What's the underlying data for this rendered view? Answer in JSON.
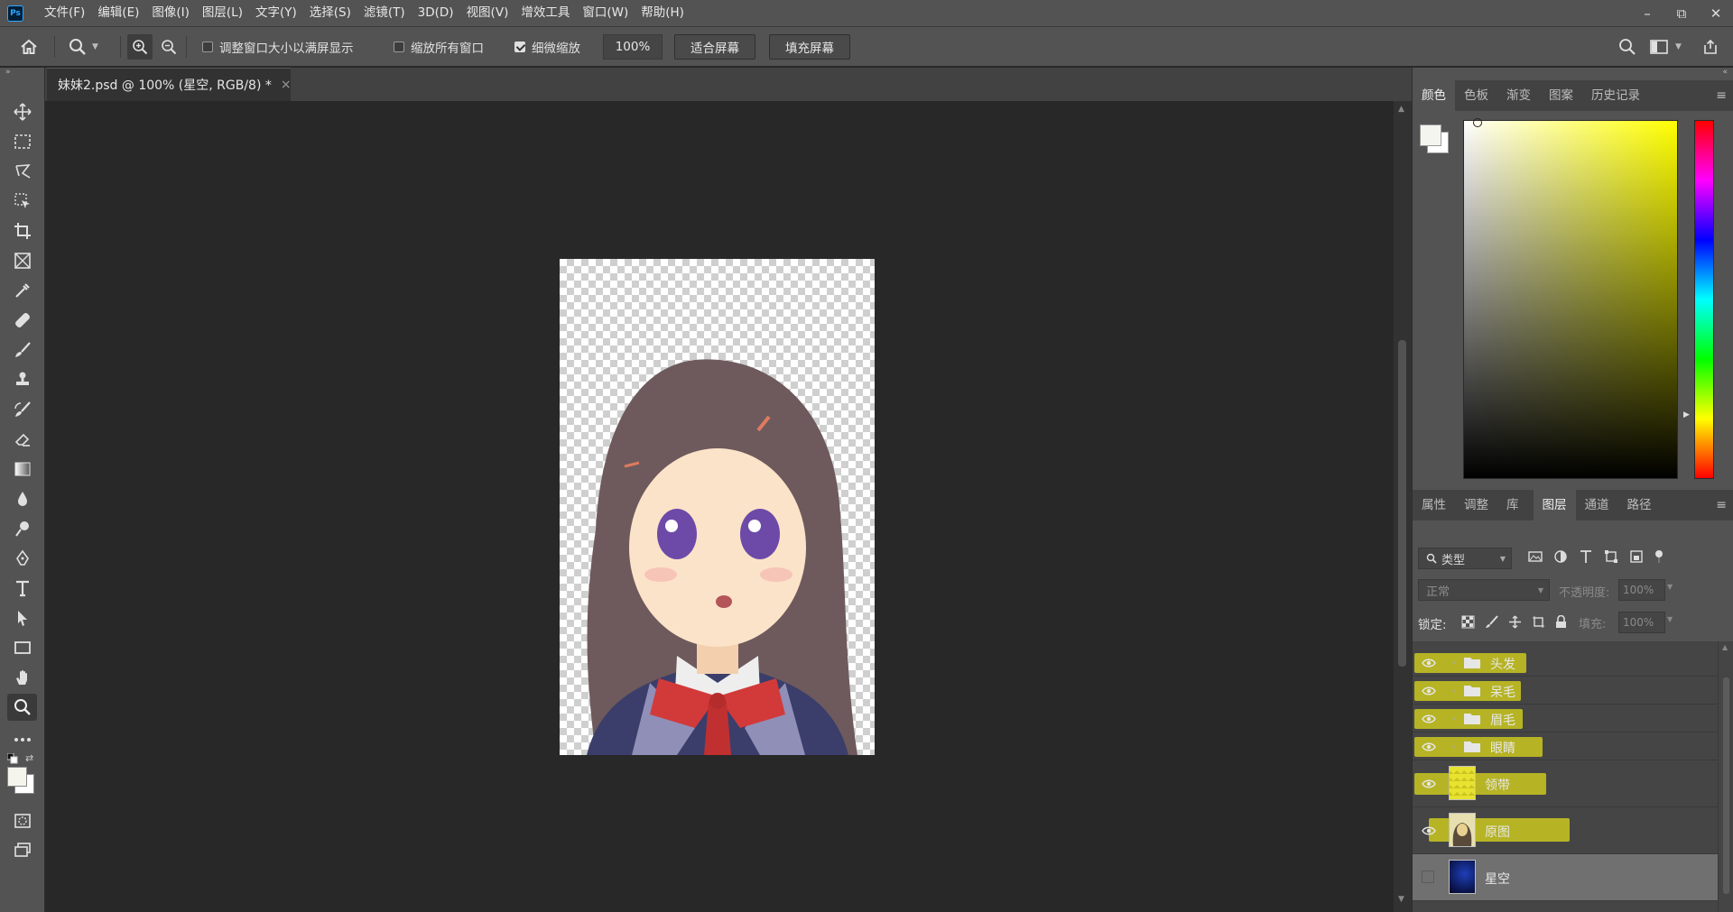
{
  "app": {
    "logo_text": "Ps",
    "menu": [
      "文件(F)",
      "编辑(E)",
      "图像(I)",
      "图层(L)",
      "文字(Y)",
      "选择(S)",
      "滤镜(T)",
      "3D(D)",
      "视图(V)",
      "增效工具",
      "窗口(W)",
      "帮助(H)"
    ]
  },
  "window_controls": {
    "minimize": "–",
    "restore": "⧉",
    "close": "✕"
  },
  "options_bar": {
    "resize_windows_label": "调整窗口大小以满屏显示",
    "resize_windows_checked": false,
    "zoom_all_label": "缩放所有窗口",
    "zoom_all_checked": false,
    "scrubby_zoom_label": "细微缩放",
    "scrubby_zoom_checked": true,
    "zoom_value": "100%",
    "fit_screen_label": "适合屏幕",
    "fill_screen_label": "填充屏幕"
  },
  "document": {
    "tab_title": "妹妹2.psd @ 100% (星空, RGB/8) *",
    "close_glyph": "×"
  },
  "tools": [
    "move-tool",
    "marquee-tool",
    "lasso-tool",
    "object-select-tool",
    "crop-tool",
    "frame-tool",
    "eyedropper-tool",
    "healing-tool",
    "brush-tool",
    "stamp-tool",
    "history-brush-tool",
    "eraser-tool",
    "gradient-tool",
    "blur-tool",
    "dodge-tool",
    "pen-tool",
    "type-tool",
    "path-select-tool",
    "rectangle-tool",
    "hand-tool",
    "zoom-tool",
    "more-tools"
  ],
  "color_panel": {
    "tabs": [
      "颜色",
      "色板",
      "渐变",
      "图案",
      "历史记录"
    ],
    "active_tab": "颜色",
    "hue_color": "#ffff00"
  },
  "layers_panel": {
    "tabs": [
      "属性",
      "调整",
      "库",
      "图层",
      "通道",
      "路径"
    ],
    "active_tab": "图层",
    "filter_label": "类型",
    "blend_mode": "正常",
    "opacity_label": "不透明度:",
    "opacity_value": "100%",
    "lock_label": "锁定:",
    "fill_label": "填充:",
    "fill_value": "100%",
    "layers": [
      {
        "name": "头发",
        "kind": "group",
        "visible": true
      },
      {
        "name": "呆毛",
        "kind": "group",
        "visible": true
      },
      {
        "name": "眉毛",
        "kind": "group",
        "visible": true
      },
      {
        "name": "眼睛",
        "kind": "group",
        "visible": true
      },
      {
        "name": "领带",
        "kind": "layer",
        "visible": true
      },
      {
        "name": "原图",
        "kind": "layer",
        "visible": true
      },
      {
        "name": "星空",
        "kind": "layer",
        "visible": false,
        "selected": true
      }
    ]
  }
}
